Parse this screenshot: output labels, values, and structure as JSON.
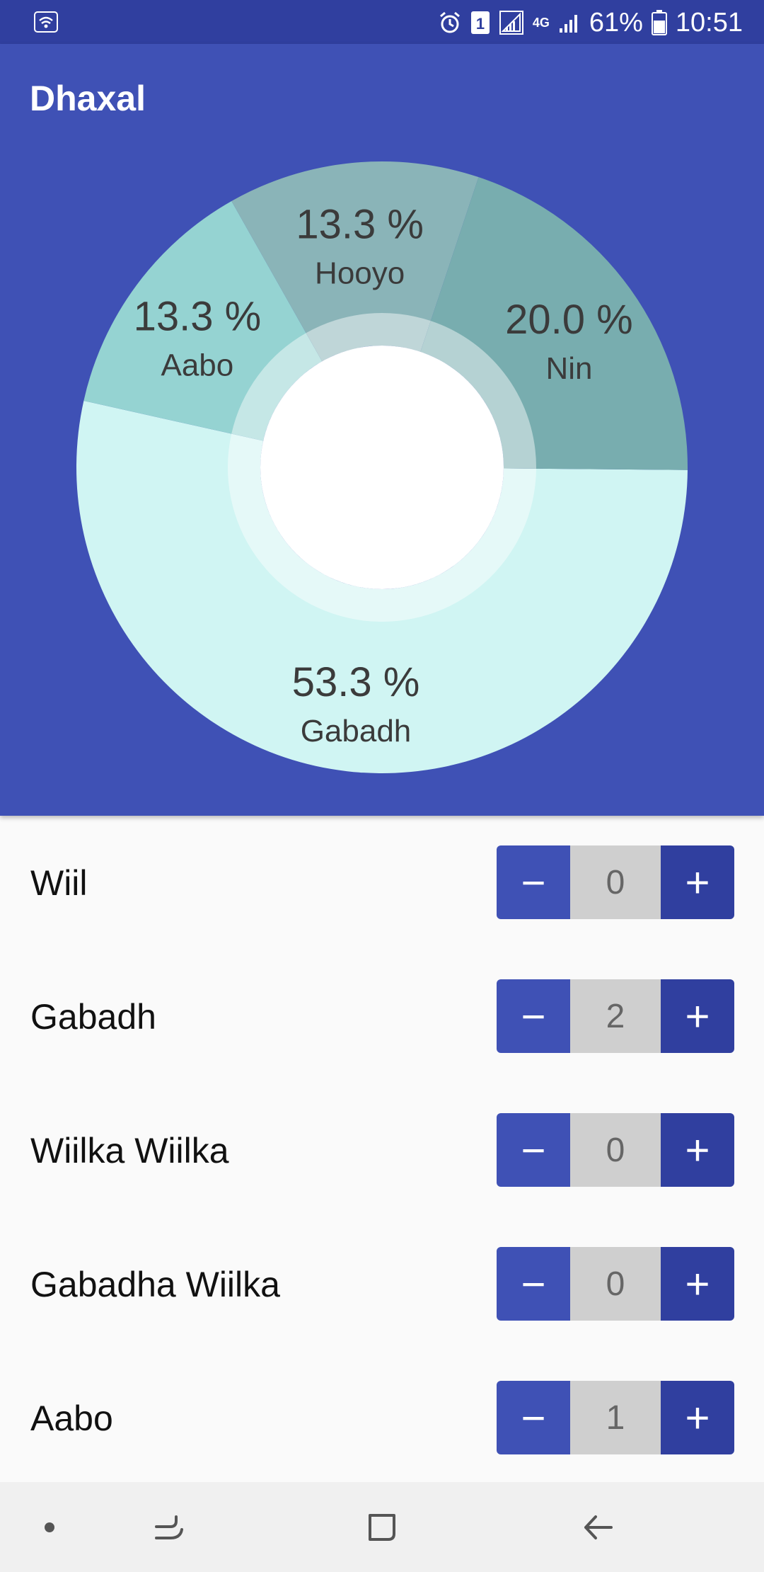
{
  "status_bar": {
    "battery": "61%",
    "time": "10:51",
    "sim_badge": "1",
    "network": "4G",
    "icons": [
      "wifi-icon",
      "alarm-icon",
      "sim-icon",
      "signal-icon",
      "network-4g-icon",
      "signal-icon",
      "battery-icon"
    ]
  },
  "app": {
    "title": "Dhaxal"
  },
  "chart_data": {
    "type": "pie",
    "variant": "donut",
    "slices": [
      {
        "label": "Gabadh",
        "value": 53.3,
        "text": "53.3 %",
        "color": "#d0f5f3"
      },
      {
        "label": "Aabo",
        "value": 13.3,
        "text": "13.3 %",
        "color": "#95d3d2"
      },
      {
        "label": "Hooyo",
        "value": 13.3,
        "text": "13.3 %",
        "color": "#8ab4b8"
      },
      {
        "label": "Nin",
        "value": 20.0,
        "text": "20.0 %",
        "color": "#78adaf"
      }
    ]
  },
  "rows": [
    {
      "label": "Wiil",
      "value": "0",
      "minus": "−",
      "plus": "+"
    },
    {
      "label": "Gabadh",
      "value": "2",
      "minus": "−",
      "plus": "+"
    },
    {
      "label": "Wiilka Wiilka",
      "value": "0",
      "minus": "−",
      "plus": "+"
    },
    {
      "label": "Gabadha Wiilka",
      "value": "0",
      "minus": "−",
      "plus": "+"
    },
    {
      "label": "Aabo",
      "value": "1",
      "minus": "−",
      "plus": "+"
    }
  ],
  "nav": {
    "icons": [
      "dot-icon",
      "recent-apps-icon",
      "home-icon",
      "back-icon"
    ]
  },
  "colors": {
    "primary": "#3f51b5",
    "primary_dark": "#303f9f",
    "stepper_value_bg": "#cfcfcf"
  }
}
